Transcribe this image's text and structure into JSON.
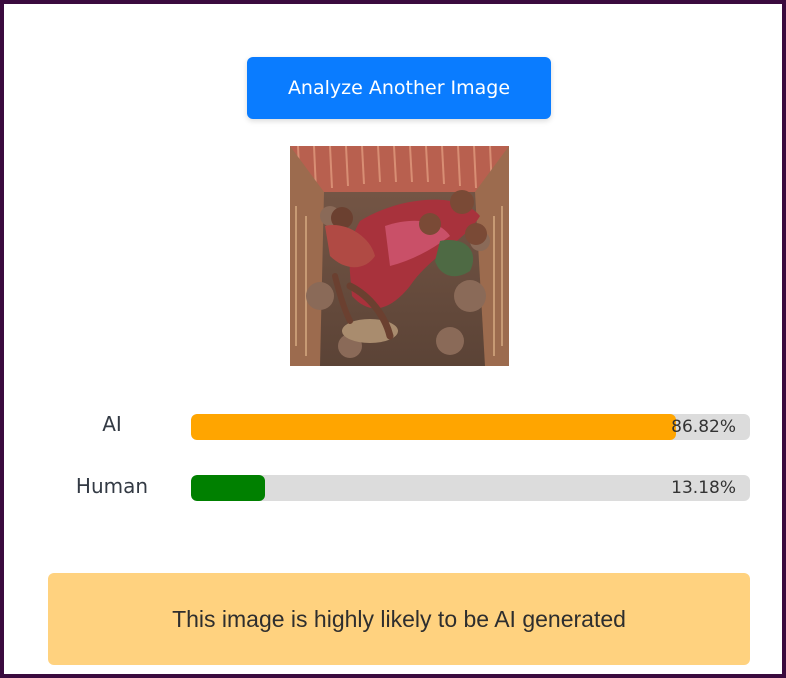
{
  "actions": {
    "analyze_label": "Analyze Another Image"
  },
  "results": [
    {
      "label": "AI",
      "percent_text": "86.82%",
      "fraction": 0.8682,
      "color": "#ffa500"
    },
    {
      "label": "Human",
      "percent_text": "13.18%",
      "fraction": 0.1318,
      "color": "#008000"
    }
  ],
  "verdict": {
    "text": "This image is highly likely to be AI generated",
    "color": "#ffd27f"
  },
  "colors": {
    "frame": "#3a0a3e",
    "button": "#0a7cff",
    "track": "#dcdcdc"
  }
}
